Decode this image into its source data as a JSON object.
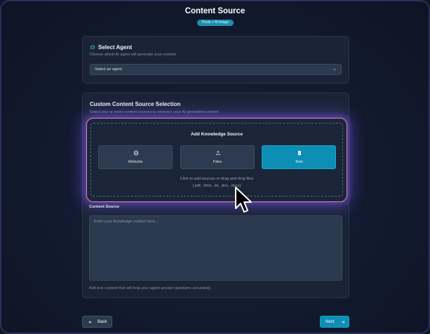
{
  "header": {
    "title": "Content Source",
    "badge": "Posts + AI Image"
  },
  "agent": {
    "icon": "robot-icon",
    "heading": "Select Agent",
    "subtitle": "Choose which AI agent will generate your content",
    "select_value": "Select an agent"
  },
  "custom_source": {
    "heading": "Custom Content Source Selection",
    "subtitle": "Select one or more content sources to enhance your AI-generated content",
    "knowledge": {
      "title": "Add Knowledge Source",
      "options": [
        {
          "label": "Website",
          "icon": "globe-icon",
          "selected": false
        },
        {
          "label": "Files",
          "icon": "upload-icon",
          "selected": false
        },
        {
          "label": "Text",
          "icon": "document-icon",
          "selected": true
        }
      ],
      "hint_line1": "Click to add sources or drag and drop files",
      "hint_line2": "(.pdf, .html, .txt, .doc, .docx)"
    },
    "content_label": "Content Source",
    "content_placeholder": "Enter your knowledge content here...",
    "content_help": "Add text content that will help your agent answer questions accurately."
  },
  "footer": {
    "back_label": "Back",
    "next_label": "Next"
  },
  "colors": {
    "accent": "#0d8fb5",
    "glow_border": "#e17fb8",
    "background": "#111a2e"
  }
}
